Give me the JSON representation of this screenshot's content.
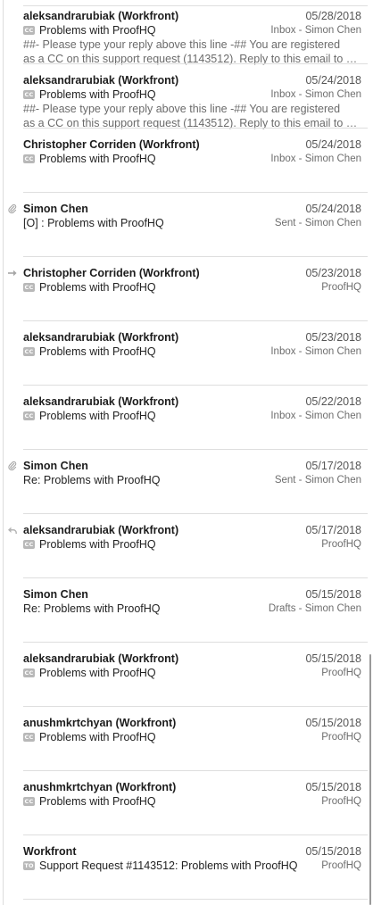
{
  "messages": [
    {
      "sender": "aleksandrarubiak (Workfront)",
      "date": "05/28/2018",
      "badge": "CC",
      "subject": "Problems with ProofHQ",
      "folder": "Inbox - Simon Chen",
      "preview_1": "##- Please type your reply above this line -## You are registered",
      "preview_2": "as a CC on this support request (1143512). Reply to this email to ad..."
    },
    {
      "sender": "aleksandrarubiak (Workfront)",
      "date": "05/24/2018",
      "badge": "CC",
      "subject": "Problems with ProofHQ",
      "folder": "Inbox - Simon Chen",
      "preview_1": "##- Please type your reply above this line -## You are registered",
      "preview_2": "as a CC on this support request (1143512). Reply to this email to ad..."
    },
    {
      "sender": "Christopher Corriden (Workfront)",
      "date": "05/24/2018",
      "badge": "CC",
      "subject": "Problems with ProofHQ",
      "folder": "Inbox - Simon Chen"
    },
    {
      "sender": "Simon Chen",
      "date": "05/24/2018",
      "subject": "[O] : Problems with ProofHQ",
      "folder": "Sent - Simon Chen",
      "icon": "paperclip-icon"
    },
    {
      "sender": "Christopher Corriden (Workfront)",
      "date": "05/23/2018",
      "badge": "CC",
      "subject": "Problems with ProofHQ",
      "folder": "ProofHQ",
      "icon": "forwarded-arrow-icon"
    },
    {
      "sender": "aleksandrarubiak (Workfront)",
      "date": "05/23/2018",
      "badge": "CC",
      "subject": "Problems with ProofHQ",
      "folder": "Inbox - Simon Chen"
    },
    {
      "sender": "aleksandrarubiak (Workfront)",
      "date": "05/22/2018",
      "badge": "CC",
      "subject": "Problems with ProofHQ",
      "folder": "Inbox - Simon Chen"
    },
    {
      "sender": "Simon Chen",
      "date": "05/17/2018",
      "subject": "Re: Problems with ProofHQ",
      "folder": "Sent - Simon Chen",
      "icon": "paperclip-icon"
    },
    {
      "sender": "aleksandrarubiak (Workfront)",
      "date": "05/17/2018",
      "badge": "CC",
      "subject": "Problems with ProofHQ",
      "folder": "ProofHQ",
      "icon": "replied-arrow-icon"
    },
    {
      "sender": "Simon Chen",
      "date": "05/15/2018",
      "subject": "Re: Problems with ProofHQ",
      "folder": "Drafts - Simon Chen"
    },
    {
      "sender": "aleksandrarubiak (Workfront)",
      "date": "05/15/2018",
      "badge": "CC",
      "subject": "Problems with ProofHQ",
      "folder": "ProofHQ"
    },
    {
      "sender": "anushmkrtchyan (Workfront)",
      "date": "05/15/2018",
      "badge": "CC",
      "subject": "Problems with ProofHQ",
      "folder": "ProofHQ"
    },
    {
      "sender": "anushmkrtchyan (Workfront)",
      "date": "05/15/2018",
      "badge": "CC",
      "subject": "Problems with ProofHQ",
      "folder": "ProofHQ"
    },
    {
      "sender": "Workfront",
      "date": "05/15/2018",
      "badge": "TO",
      "subject": "Support Request #1143512: Problems with ProofHQ",
      "folder": "ProofHQ"
    }
  ]
}
